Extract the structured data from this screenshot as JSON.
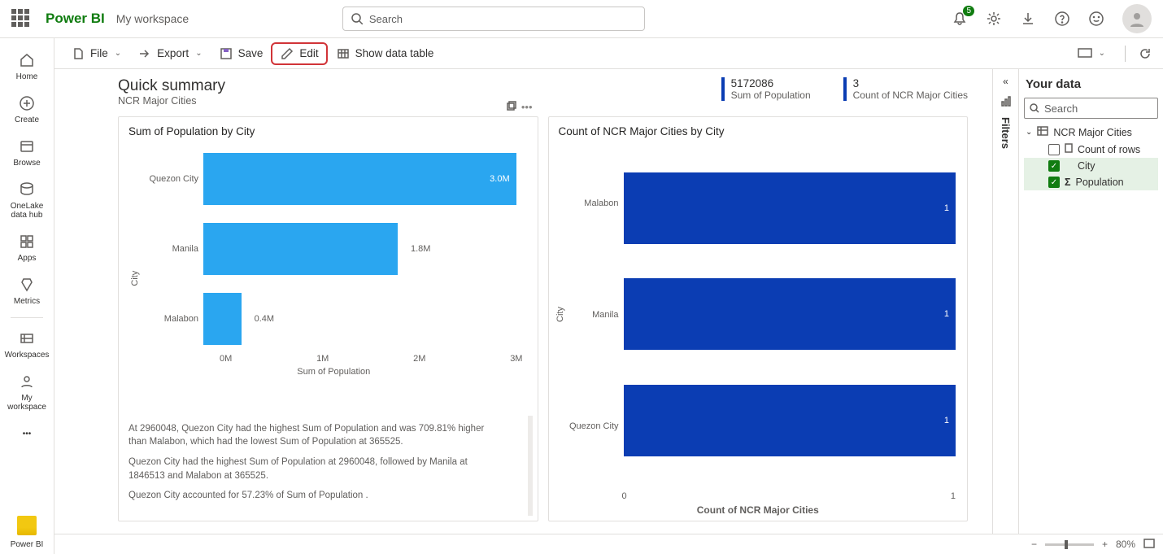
{
  "header": {
    "brand": "Power BI",
    "workspace": "My workspace",
    "search_placeholder": "Search",
    "notification_badge": "5"
  },
  "leftnav": {
    "home": "Home",
    "create": "Create",
    "browse": "Browse",
    "onelake": "OneLake data hub",
    "apps": "Apps",
    "metrics": "Metrics",
    "workspaces": "Workspaces",
    "myworkspace": "My workspace",
    "powerbi": "Power BI"
  },
  "toolbar": {
    "file": "File",
    "export": "Export",
    "save": "Save",
    "edit": "Edit",
    "show_table": "Show data table"
  },
  "summary": {
    "title": "Quick summary",
    "subtitle": "NCR Major Cities",
    "stat1_val": "5172086",
    "stat1_lbl": "Sum of Population",
    "stat2_val": "3",
    "stat2_lbl": "Count of NCR Major Cities"
  },
  "chart_data": [
    {
      "type": "bar",
      "orientation": "horizontal",
      "title": "Sum of Population by City",
      "ylabel": "City",
      "xlabel": "Sum of Population",
      "x_ticks": [
        "0M",
        "1M",
        "2M",
        "3M"
      ],
      "categories": [
        "Quezon City",
        "Manila",
        "Malabon"
      ],
      "values": [
        2960048,
        1846513,
        365525
      ],
      "value_labels": [
        "3.0M",
        "1.8M",
        "0.4M"
      ],
      "xlim": [
        0,
        3000000
      ],
      "color": "#2aa6f0",
      "insights": [
        "At 2960048, Quezon City had the highest Sum of Population  and was 709.81% higher than Malabon, which had the lowest Sum of Population  at 365525.",
        "Quezon City had the highest Sum of Population  at 2960048, followed by Manila at 1846513 and Malabon at 365525.",
        "Quezon City accounted for 57.23% of Sum of Population ."
      ]
    },
    {
      "type": "bar",
      "orientation": "horizontal",
      "title": "Count of NCR Major Cities by City",
      "ylabel": "City",
      "xlabel": "Count of NCR Major Cities",
      "x_ticks": [
        "0",
        "1"
      ],
      "categories": [
        "Malabon",
        "Manila",
        "Quezon City"
      ],
      "values": [
        1,
        1,
        1
      ],
      "value_labels": [
        "1",
        "1",
        "1"
      ],
      "xlim": [
        0,
        1
      ],
      "color": "#0b3db3"
    }
  ],
  "filters_label": "Filters",
  "datapanel": {
    "title": "Your data",
    "search_placeholder": "Search",
    "table": "NCR Major Cities",
    "fields": {
      "count": "Count of rows",
      "city": "City",
      "population": "Population"
    }
  },
  "status": {
    "zoom_minus": "−",
    "zoom_plus": "+",
    "zoom_pct": "80%"
  }
}
